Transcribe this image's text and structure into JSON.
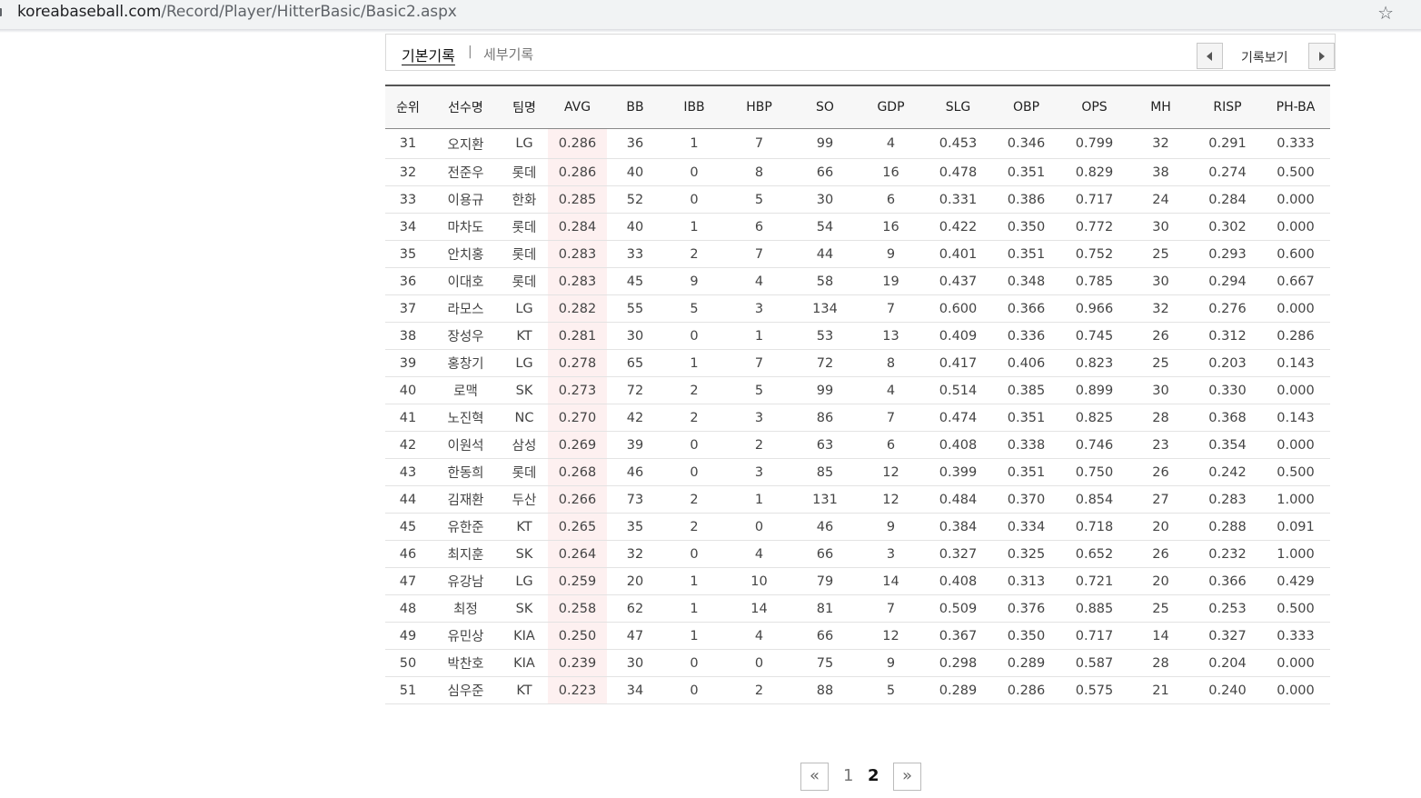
{
  "browser": {
    "url_domain": "koreabaseball.com",
    "url_path": "/Record/Player/HitterBasic/Basic2.aspx"
  },
  "tabs": {
    "basic": "기본기록",
    "separator": "|",
    "detail": "세부기록",
    "view_label": "기록보기"
  },
  "table": {
    "headers": [
      "순위",
      "선수명",
      "팀명",
      "AVG",
      "BB",
      "IBB",
      "HBP",
      "SO",
      "GDP",
      "SLG",
      "OBP",
      "OPS",
      "MH",
      "RISP",
      "PH-BA"
    ],
    "rows": [
      [
        "31",
        "오지환",
        "LG",
        "0.286",
        "36",
        "1",
        "7",
        "99",
        "4",
        "0.453",
        "0.346",
        "0.799",
        "32",
        "0.291",
        "0.333"
      ],
      [
        "32",
        "전준우",
        "롯데",
        "0.286",
        "40",
        "0",
        "8",
        "66",
        "16",
        "0.478",
        "0.351",
        "0.829",
        "38",
        "0.274",
        "0.500"
      ],
      [
        "33",
        "이용규",
        "한화",
        "0.285",
        "52",
        "0",
        "5",
        "30",
        "6",
        "0.331",
        "0.386",
        "0.717",
        "24",
        "0.284",
        "0.000"
      ],
      [
        "34",
        "마차도",
        "롯데",
        "0.284",
        "40",
        "1",
        "6",
        "54",
        "16",
        "0.422",
        "0.350",
        "0.772",
        "30",
        "0.302",
        "0.000"
      ],
      [
        "35",
        "안치홍",
        "롯데",
        "0.283",
        "33",
        "2",
        "7",
        "44",
        "9",
        "0.401",
        "0.351",
        "0.752",
        "25",
        "0.293",
        "0.600"
      ],
      [
        "36",
        "이대호",
        "롯데",
        "0.283",
        "45",
        "9",
        "4",
        "58",
        "19",
        "0.437",
        "0.348",
        "0.785",
        "30",
        "0.294",
        "0.667"
      ],
      [
        "37",
        "라모스",
        "LG",
        "0.282",
        "55",
        "5",
        "3",
        "134",
        "7",
        "0.600",
        "0.366",
        "0.966",
        "32",
        "0.276",
        "0.000"
      ],
      [
        "38",
        "장성우",
        "KT",
        "0.281",
        "30",
        "0",
        "1",
        "53",
        "13",
        "0.409",
        "0.336",
        "0.745",
        "26",
        "0.312",
        "0.286"
      ],
      [
        "39",
        "홍창기",
        "LG",
        "0.278",
        "65",
        "1",
        "7",
        "72",
        "8",
        "0.417",
        "0.406",
        "0.823",
        "25",
        "0.203",
        "0.143"
      ],
      [
        "40",
        "로맥",
        "SK",
        "0.273",
        "72",
        "2",
        "5",
        "99",
        "4",
        "0.514",
        "0.385",
        "0.899",
        "30",
        "0.330",
        "0.000"
      ],
      [
        "41",
        "노진혁",
        "NC",
        "0.270",
        "42",
        "2",
        "3",
        "86",
        "7",
        "0.474",
        "0.351",
        "0.825",
        "28",
        "0.368",
        "0.143"
      ],
      [
        "42",
        "이원석",
        "삼성",
        "0.269",
        "39",
        "0",
        "2",
        "63",
        "6",
        "0.408",
        "0.338",
        "0.746",
        "23",
        "0.354",
        "0.000"
      ],
      [
        "43",
        "한동희",
        "롯데",
        "0.268",
        "46",
        "0",
        "3",
        "85",
        "12",
        "0.399",
        "0.351",
        "0.750",
        "26",
        "0.242",
        "0.500"
      ],
      [
        "44",
        "김재환",
        "두산",
        "0.266",
        "73",
        "2",
        "1",
        "131",
        "12",
        "0.484",
        "0.370",
        "0.854",
        "27",
        "0.283",
        "1.000"
      ],
      [
        "45",
        "유한준",
        "KT",
        "0.265",
        "35",
        "2",
        "0",
        "46",
        "9",
        "0.384",
        "0.334",
        "0.718",
        "20",
        "0.288",
        "0.091"
      ],
      [
        "46",
        "최지훈",
        "SK",
        "0.264",
        "32",
        "0",
        "4",
        "66",
        "3",
        "0.327",
        "0.325",
        "0.652",
        "26",
        "0.232",
        "1.000"
      ],
      [
        "47",
        "유강남",
        "LG",
        "0.259",
        "20",
        "1",
        "10",
        "79",
        "14",
        "0.408",
        "0.313",
        "0.721",
        "20",
        "0.366",
        "0.429"
      ],
      [
        "48",
        "최정",
        "SK",
        "0.258",
        "62",
        "1",
        "14",
        "81",
        "7",
        "0.509",
        "0.376",
        "0.885",
        "25",
        "0.253",
        "0.500"
      ],
      [
        "49",
        "유민상",
        "KIA",
        "0.250",
        "47",
        "1",
        "4",
        "66",
        "12",
        "0.367",
        "0.350",
        "0.717",
        "14",
        "0.327",
        "0.333"
      ],
      [
        "50",
        "박찬호",
        "KIA",
        "0.239",
        "30",
        "0",
        "0",
        "75",
        "9",
        "0.298",
        "0.289",
        "0.587",
        "28",
        "0.204",
        "0.000"
      ],
      [
        "51",
        "심우준",
        "KT",
        "0.223",
        "34",
        "0",
        "2",
        "88",
        "5",
        "0.289",
        "0.286",
        "0.575",
        "21",
        "0.240",
        "0.000"
      ]
    ]
  },
  "pagination": {
    "first": "«",
    "pages": [
      "1",
      "2"
    ],
    "current": "2",
    "last": "»"
  },
  "colors": {
    "avg_highlight": "#fdf0f0",
    "header_border": "#555555"
  }
}
